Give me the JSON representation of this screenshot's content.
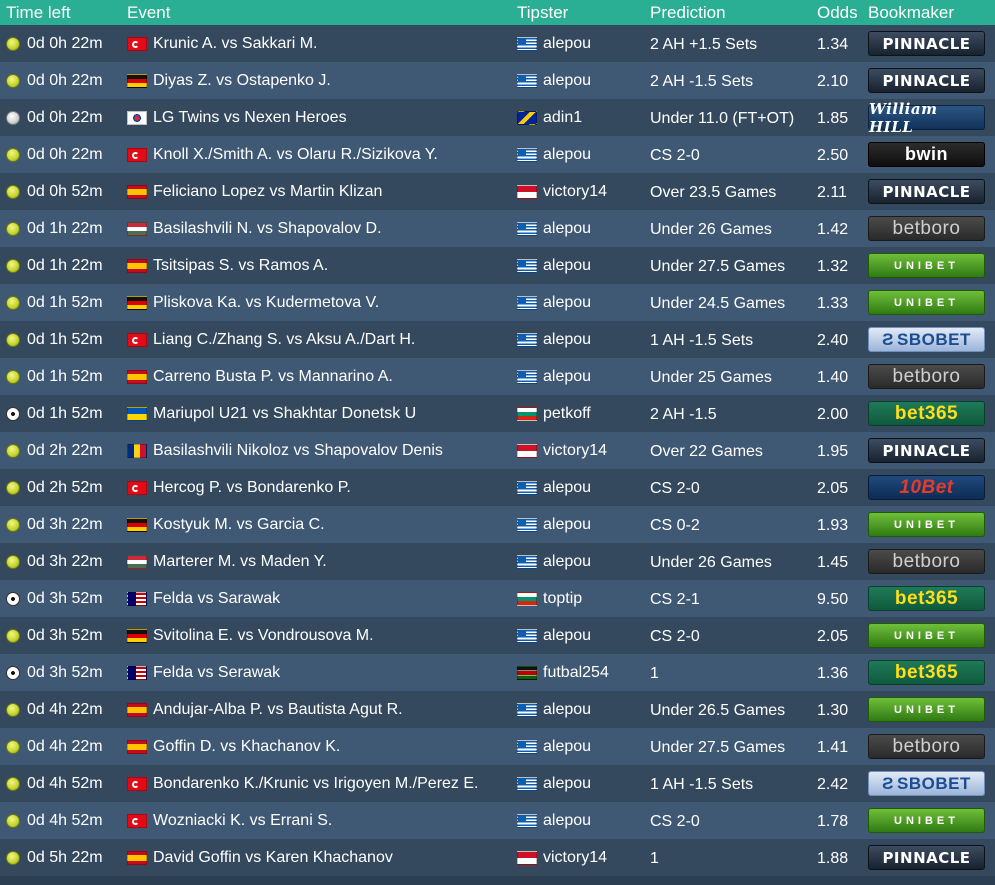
{
  "headers": {
    "time_left": "Time left",
    "event": "Event",
    "tipster": "Tipster",
    "prediction": "Prediction",
    "odds": "Odds",
    "bookmaker": "Bookmaker"
  },
  "rows": [
    {
      "sport": "tennis",
      "time": "0d 0h 22m",
      "flag": "tr",
      "event": "Krunic A. vs Sakkari M.",
      "tipster_flag": "gr",
      "tipster": "alepou",
      "prediction": "2 AH +1.5 Sets",
      "odds": "1.34",
      "bookmaker": "pinnacle",
      "bookmaker_label": "PINNACLE"
    },
    {
      "sport": "tennis",
      "time": "0d 0h 22m",
      "flag": "de",
      "event": "Diyas Z. vs Ostapenko J.",
      "tipster_flag": "gr",
      "tipster": "alepou",
      "prediction": "2 AH -1.5 Sets",
      "odds": "2.10",
      "bookmaker": "pinnacle",
      "bookmaker_label": "PINNACLE"
    },
    {
      "sport": "baseball",
      "time": "0d 0h 22m",
      "flag": "kr",
      "event": "LG Twins vs Nexen Heroes",
      "tipster_flag": "ba",
      "tipster": "adin1",
      "prediction": "Under 11.0 (FT+OT)",
      "odds": "1.85",
      "bookmaker": "williamhill",
      "bookmaker_label": "William HILL"
    },
    {
      "sport": "tennis",
      "time": "0d 0h 22m",
      "flag": "tr",
      "event": "Knoll X./Smith A. vs Olaru R./Sizikova Y.",
      "tipster_flag": "gr",
      "tipster": "alepou",
      "prediction": "CS 2-0",
      "odds": "2.50",
      "bookmaker": "bwin",
      "bookmaker_label": "bwin"
    },
    {
      "sport": "tennis",
      "time": "0d 0h 52m",
      "flag": "es",
      "event": "Feliciano Lopez vs Martin Klizan",
      "tipster_flag": "id",
      "tipster": "victory14",
      "prediction": "Over 23.5 Games",
      "odds": "2.11",
      "bookmaker": "pinnacle",
      "bookmaker_label": "PINNACLE"
    },
    {
      "sport": "tennis",
      "time": "0d 1h 22m",
      "flag": "hu",
      "event": "Basilashvili N. vs Shapovalov D.",
      "tipster_flag": "gr",
      "tipster": "alepou",
      "prediction": "Under 26 Games",
      "odds": "1.42",
      "bookmaker": "betboro",
      "bookmaker_label": "betboro"
    },
    {
      "sport": "tennis",
      "time": "0d 1h 22m",
      "flag": "es",
      "event": "Tsitsipas S. vs Ramos A.",
      "tipster_flag": "gr",
      "tipster": "alepou",
      "prediction": "Under 27.5 Games",
      "odds": "1.32",
      "bookmaker": "unibet",
      "bookmaker_label": "UNIBET"
    },
    {
      "sport": "tennis",
      "time": "0d 1h 52m",
      "flag": "de",
      "event": "Pliskova Ka. vs Kudermetova V.",
      "tipster_flag": "gr",
      "tipster": "alepou",
      "prediction": "Under 24.5 Games",
      "odds": "1.33",
      "bookmaker": "unibet",
      "bookmaker_label": "UNIBET"
    },
    {
      "sport": "tennis",
      "time": "0d 1h 52m",
      "flag": "tr",
      "event": "Liang C./Zhang S. vs Aksu A./Dart H.",
      "tipster_flag": "gr",
      "tipster": "alepou",
      "prediction": "1 AH -1.5 Sets",
      "odds": "2.40",
      "bookmaker": "sbobet",
      "bookmaker_label": "SBOBET"
    },
    {
      "sport": "tennis",
      "time": "0d 1h 52m",
      "flag": "es",
      "event": "Carreno Busta P. vs Mannarino A.",
      "tipster_flag": "gr",
      "tipster": "alepou",
      "prediction": "Under 25 Games",
      "odds": "1.40",
      "bookmaker": "betboro",
      "bookmaker_label": "betboro"
    },
    {
      "sport": "football",
      "time": "0d 1h 52m",
      "flag": "ua",
      "event": "Mariupol U21 vs Shakhtar Donetsk U",
      "tipster_flag": "bg",
      "tipster": "petkoff",
      "prediction": "2 AH -1.5",
      "odds": "2.00",
      "bookmaker": "bet365",
      "bookmaker_label": "bet365"
    },
    {
      "sport": "tennis",
      "time": "0d 2h 22m",
      "flag": "ro",
      "event": "Basilashvili Nikoloz vs Shapovalov Denis",
      "tipster_flag": "id",
      "tipster": "victory14",
      "prediction": "Over 22 Games",
      "odds": "1.95",
      "bookmaker": "pinnacle",
      "bookmaker_label": "PINNACLE"
    },
    {
      "sport": "tennis",
      "time": "0d 2h 52m",
      "flag": "tr",
      "event": "Hercog P. vs Bondarenko P.",
      "tipster_flag": "gr",
      "tipster": "alepou",
      "prediction": "CS 2-0",
      "odds": "2.05",
      "bookmaker": "tenbet",
      "bookmaker_label": "10Bet"
    },
    {
      "sport": "tennis",
      "time": "0d 3h 22m",
      "flag": "de",
      "event": "Kostyuk M. vs Garcia C.",
      "tipster_flag": "gr",
      "tipster": "alepou",
      "prediction": "CS 0-2",
      "odds": "1.93",
      "bookmaker": "unibet",
      "bookmaker_label": "UNIBET"
    },
    {
      "sport": "tennis",
      "time": "0d 3h 22m",
      "flag": "hu",
      "event": "Marterer M. vs Maden Y.",
      "tipster_flag": "gr",
      "tipster": "alepou",
      "prediction": "Under 26 Games",
      "odds": "1.45",
      "bookmaker": "betboro",
      "bookmaker_label": "betboro"
    },
    {
      "sport": "football",
      "time": "0d 3h 52m",
      "flag": "my",
      "event": "Felda vs Sarawak",
      "tipster_flag": "bg",
      "tipster": "toptip",
      "prediction": "CS 2-1",
      "odds": "9.50",
      "bookmaker": "bet365",
      "bookmaker_label": "bet365"
    },
    {
      "sport": "tennis",
      "time": "0d 3h 52m",
      "flag": "de",
      "event": "Svitolina E. vs Vondrousova M.",
      "tipster_flag": "gr",
      "tipster": "alepou",
      "prediction": "CS 2-0",
      "odds": "2.05",
      "bookmaker": "unibet",
      "bookmaker_label": "UNIBET"
    },
    {
      "sport": "football",
      "time": "0d 3h 52m",
      "flag": "my",
      "event": "Felda vs Serawak",
      "tipster_flag": "ke",
      "tipster": "futbal254",
      "prediction": "1",
      "odds": "1.36",
      "bookmaker": "bet365",
      "bookmaker_label": "bet365"
    },
    {
      "sport": "tennis",
      "time": "0d 4h 22m",
      "flag": "es",
      "event": "Andujar-Alba P. vs Bautista Agut R.",
      "tipster_flag": "gr",
      "tipster": "alepou",
      "prediction": "Under 26.5 Games",
      "odds": "1.30",
      "bookmaker": "unibet",
      "bookmaker_label": "UNIBET"
    },
    {
      "sport": "tennis",
      "time": "0d 4h 22m",
      "flag": "es",
      "event": "Goffin D. vs Khachanov K.",
      "tipster_flag": "gr",
      "tipster": "alepou",
      "prediction": "Under 27.5 Games",
      "odds": "1.41",
      "bookmaker": "betboro",
      "bookmaker_label": "betboro"
    },
    {
      "sport": "tennis",
      "time": "0d 4h 52m",
      "flag": "tr",
      "event": "Bondarenko K./Krunic vs Irigoyen M./Perez E.",
      "tipster_flag": "gr",
      "tipster": "alepou",
      "prediction": "1 AH -1.5 Sets",
      "odds": "2.42",
      "bookmaker": "sbobet",
      "bookmaker_label": "SBOBET"
    },
    {
      "sport": "tennis",
      "time": "0d 4h 52m",
      "flag": "tr",
      "event": "Wozniacki K. vs Errani S.",
      "tipster_flag": "gr",
      "tipster": "alepou",
      "prediction": "CS 2-0",
      "odds": "1.78",
      "bookmaker": "unibet",
      "bookmaker_label": "UNIBET"
    },
    {
      "sport": "tennis",
      "time": "0d 5h 22m",
      "flag": "es",
      "event": "David Goffin vs Karen Khachanov",
      "tipster_flag": "id",
      "tipster": "victory14",
      "prediction": "1",
      "odds": "1.88",
      "bookmaker": "pinnacle",
      "bookmaker_label": "PINNACLE"
    }
  ],
  "colors": {
    "header_bg": "#2aaf94",
    "row_odd": "#34495e",
    "row_even": "#3f5873",
    "text": "#ffffff"
  }
}
